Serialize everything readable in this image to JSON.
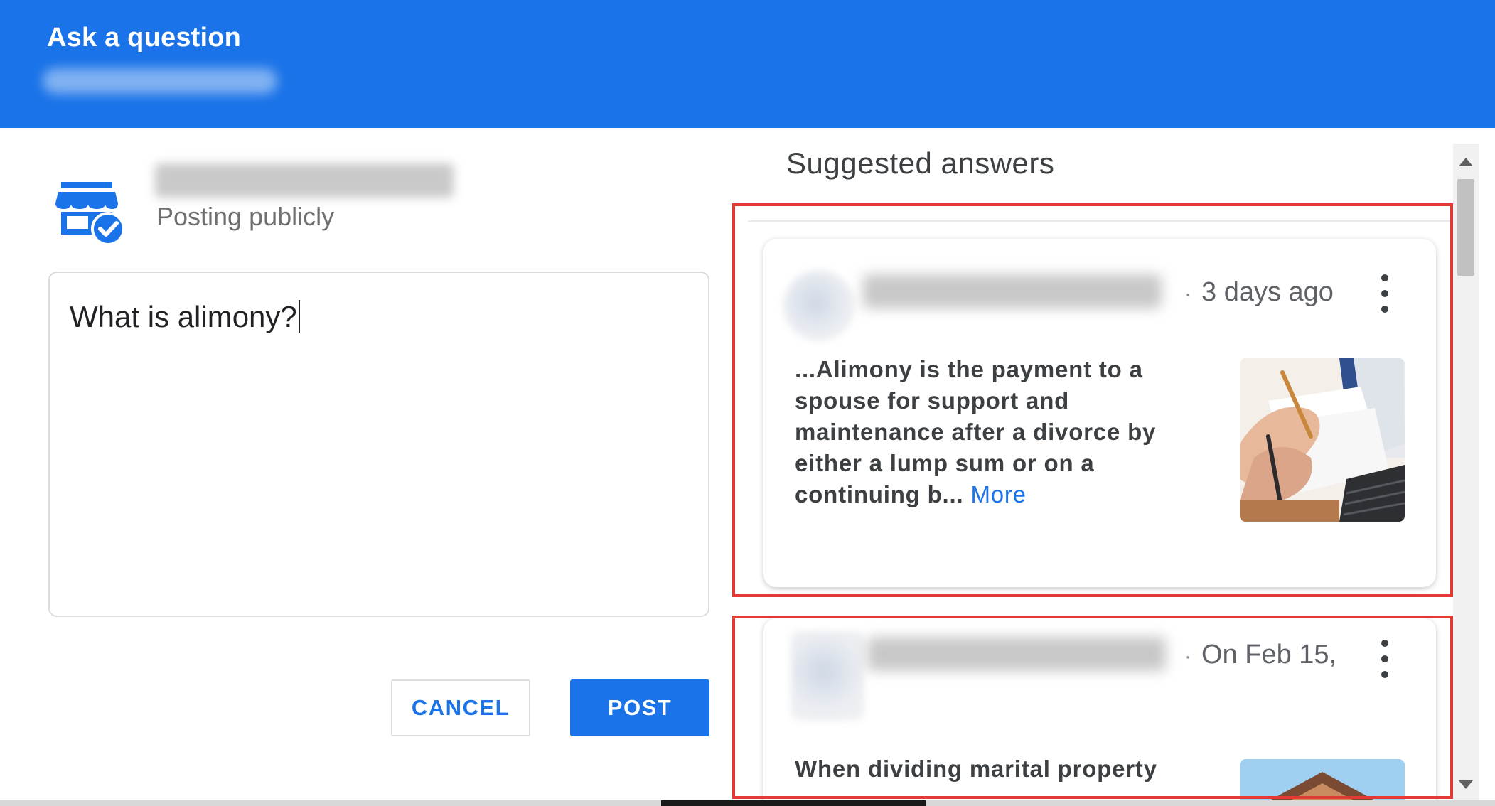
{
  "header": {
    "title": "Ask a question"
  },
  "left": {
    "posting_label": "Posting publicly",
    "question_value": "What is alimony?",
    "buttons": {
      "cancel": "CANCEL",
      "post": "POST"
    }
  },
  "right": {
    "title": "Suggested answers",
    "answers": [
      {
        "time": "3 days ago",
        "snippet": "...Alimony is the payment to a spouse for support and maintenance after a divorce by either a lump sum or on a continuing b...",
        "more_label": "More"
      },
      {
        "time": "On Feb 15,",
        "snippet": "When dividing marital property"
      }
    ]
  },
  "colors": {
    "brand_blue": "#1a73e8",
    "highlight_red": "#e53935"
  },
  "icons": [
    "store-verified-icon",
    "more-vert-icon",
    "scroll-up-arrow-icon",
    "scroll-down-arrow-icon"
  ]
}
